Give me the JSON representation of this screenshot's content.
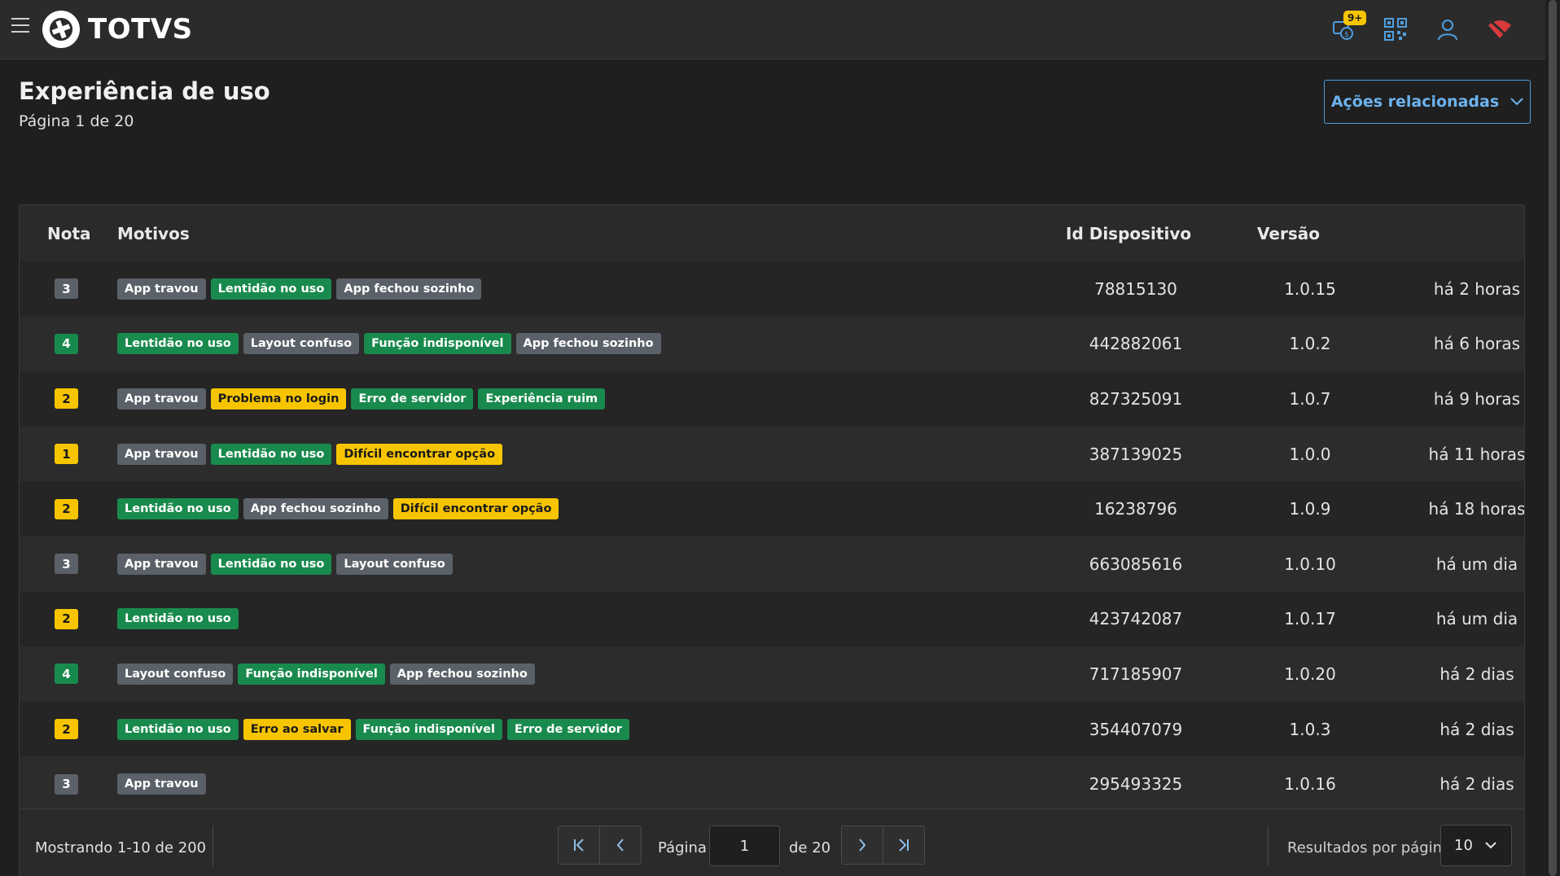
{
  "app": {
    "brand": "TOTVS"
  },
  "topbar": {
    "notification_badge": "9+"
  },
  "header": {
    "title": "Experiência de uso",
    "subtitle": "Página 1 de 20",
    "actions_label": "Ações relacionadas"
  },
  "table": {
    "columns": {
      "nota": "Nota",
      "motivos": "Motivos",
      "id": "Id Dispositivo",
      "versao": "Versão",
      "tempo": ""
    },
    "rows": [
      {
        "nota": "3",
        "nota_color": "#5b6168",
        "motivos": [
          [
            "App travou",
            "gray"
          ],
          [
            "Lentidão no uso",
            "green"
          ],
          [
            "App fechou sozinho",
            "gray"
          ]
        ],
        "id": "78815130",
        "versao": "1.0.15",
        "tempo": "há 2 horas"
      },
      {
        "nota": "4",
        "nota_color": "#198a4d",
        "motivos": [
          [
            "Lentidão no uso",
            "green"
          ],
          [
            "Layout confuso",
            "gray"
          ],
          [
            "Função indisponível",
            "green"
          ],
          [
            "App fechou sozinho",
            "gray"
          ]
        ],
        "id": "442882061",
        "versao": "1.0.2",
        "tempo": "há 6 horas"
      },
      {
        "nota": "2",
        "nota_color": "#f7c500",
        "motivos": [
          [
            "App travou",
            "gray"
          ],
          [
            "Problema no login",
            "yellow"
          ],
          [
            "Erro de servidor",
            "green"
          ],
          [
            "Experiência ruim",
            "green"
          ]
        ],
        "id": "827325091",
        "versao": "1.0.7",
        "tempo": "há 9 horas"
      },
      {
        "nota": "1",
        "nota_color": "#f7c500",
        "motivos": [
          [
            "App travou",
            "gray"
          ],
          [
            "Lentidão no uso",
            "green"
          ],
          [
            "Difícil encontrar opção",
            "yellow"
          ]
        ],
        "id": "387139025",
        "versao": "1.0.0",
        "tempo": "há 11 horas"
      },
      {
        "nota": "2",
        "nota_color": "#f7c500",
        "motivos": [
          [
            "Lentidão no uso",
            "green"
          ],
          [
            "App fechou sozinho",
            "gray"
          ],
          [
            "Difícil encontrar opção",
            "yellow"
          ]
        ],
        "id": "16238796",
        "versao": "1.0.9",
        "tempo": "há 18 horas"
      },
      {
        "nota": "3",
        "nota_color": "#5b6168",
        "motivos": [
          [
            "App travou",
            "gray"
          ],
          [
            "Lentidão no uso",
            "green"
          ],
          [
            "Layout confuso",
            "gray"
          ]
        ],
        "id": "663085616",
        "versao": "1.0.10",
        "tempo": "há um dia"
      },
      {
        "nota": "2",
        "nota_color": "#f7c500",
        "motivos": [
          [
            "Lentidão no uso",
            "green"
          ]
        ],
        "id": "423742087",
        "versao": "1.0.17",
        "tempo": "há um dia"
      },
      {
        "nota": "4",
        "nota_color": "#198a4d",
        "motivos": [
          [
            "Layout confuso",
            "gray"
          ],
          [
            "Função indisponível",
            "green"
          ],
          [
            "App fechou sozinho",
            "gray"
          ]
        ],
        "id": "717185907",
        "versao": "1.0.20",
        "tempo": "há 2 dias"
      },
      {
        "nota": "2",
        "nota_color": "#f7c500",
        "motivos": [
          [
            "Lentidão no uso",
            "green"
          ],
          [
            "Erro ao salvar",
            "yellow"
          ],
          [
            "Função indisponível",
            "green"
          ],
          [
            "Erro de servidor",
            "green"
          ]
        ],
        "id": "354407079",
        "versao": "1.0.3",
        "tempo": "há 2 dias"
      },
      {
        "nota": "3",
        "nota_color": "#5b6168",
        "motivos": [
          [
            "App travou",
            "gray"
          ]
        ],
        "id": "295493325",
        "versao": "1.0.16",
        "tempo": "há 2 dias"
      }
    ]
  },
  "pagination": {
    "showing": "Mostrando 1-10 de 200",
    "page_label": "Página",
    "current_page": "1",
    "of_label": "de 20",
    "per_page_label": "Resultados por página",
    "per_page_value": "10"
  },
  "colors": {
    "accent": "#4f9fe0",
    "badge": "#f7c500"
  }
}
